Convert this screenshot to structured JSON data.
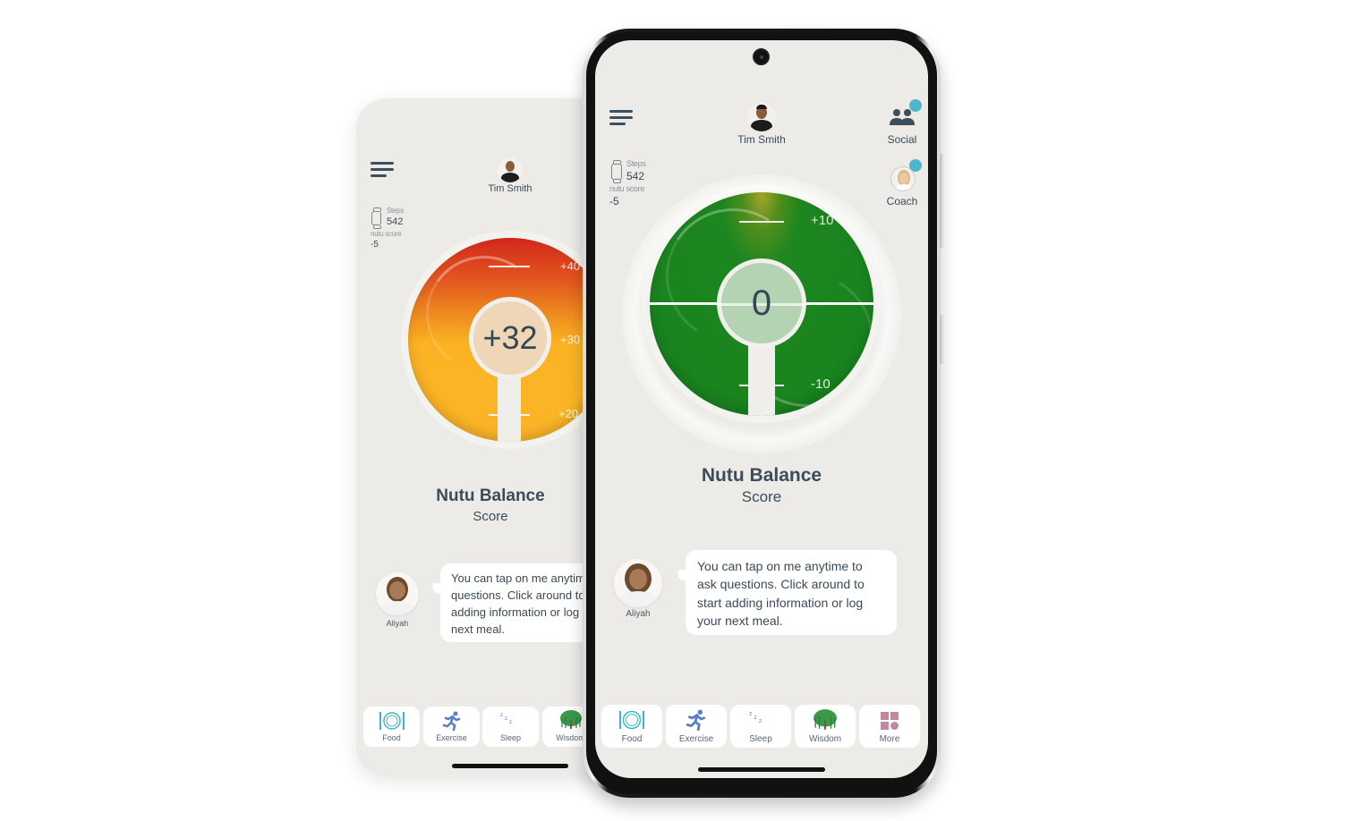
{
  "app": {
    "user_name": "Tim Smith",
    "steps_label": "Steps",
    "steps_value": "542",
    "nutu_score_label": "nutu score",
    "nutu_score_value": "-5",
    "social_label": "Social",
    "coach_label": "Coach",
    "title": "Nutu Balance",
    "subtitle": "Score",
    "assistant": {
      "name": "Aliyah",
      "message": "You can tap on me anytime to ask questions. Click around to start adding information or log your next meal."
    },
    "nav": [
      {
        "label": "Food",
        "icon": "food-icon"
      },
      {
        "label": "Exercise",
        "icon": "exercise-icon"
      },
      {
        "label": "Sleep",
        "icon": "sleep-icon"
      },
      {
        "label": "Wisdom",
        "icon": "wisdom-icon"
      },
      {
        "label": "More",
        "icon": "more-icon"
      }
    ]
  },
  "back_phone": {
    "score": "+32",
    "ticks": [
      "+40",
      "+30",
      "+20"
    ],
    "gauge_colors": {
      "top": "#d2281b",
      "bottom": "#fbb528"
    },
    "message_visible": "You can tap on me anytim ask questions. Click arou start adding information c your next meal."
  },
  "front_phone": {
    "score": "0",
    "ticks": [
      "+10",
      "-10"
    ],
    "gauge_color": "#17821e",
    "badge_color": "#4fb6cc"
  }
}
